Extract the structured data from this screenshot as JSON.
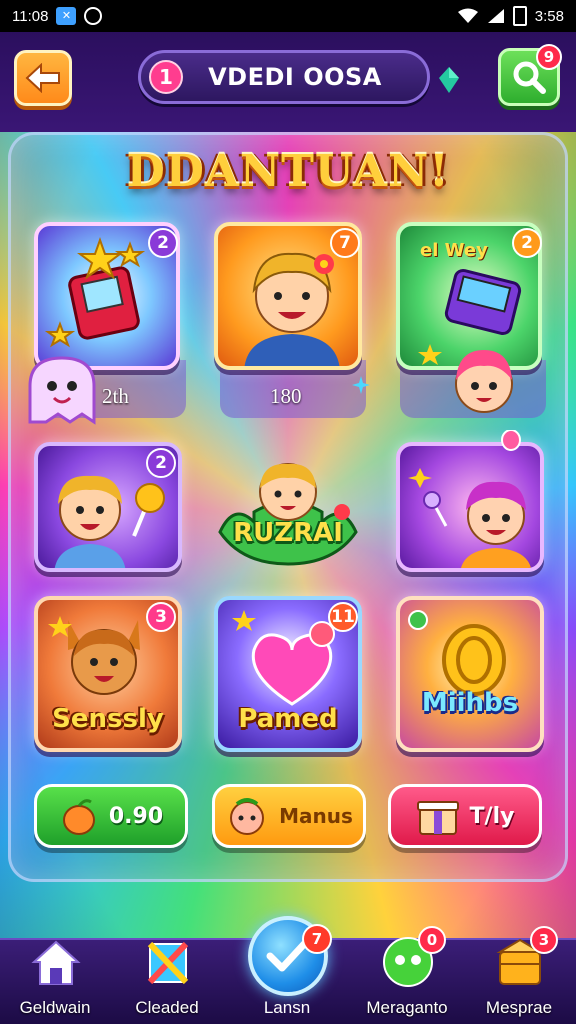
{
  "status_bar": {
    "time_left": "11:08",
    "time_right": "3:58"
  },
  "top_bar": {
    "level": "1",
    "title": "VDEDI OOSA",
    "search_badge": "9"
  },
  "headline": "DDANTUAN!",
  "cards": [
    {
      "id": "arcade",
      "badge": "2",
      "caption": "2th"
    },
    {
      "id": "boy-flower",
      "badge": "7",
      "caption": "180"
    },
    {
      "id": "chest",
      "badge": "2",
      "sign": "el Wey"
    },
    {
      "id": "fox-lollipop",
      "badge": "2"
    },
    {
      "id": "center-puzzle",
      "label": "RUZRAI"
    },
    {
      "id": "girl-wand"
    },
    {
      "id": "fox",
      "badge": "3",
      "label": "Senssly"
    },
    {
      "id": "heart",
      "badge": "11",
      "label": "Pamed"
    },
    {
      "id": "coin",
      "label": "Miihbs"
    }
  ],
  "buttons": [
    {
      "label": "0.90",
      "color": "#2bbf3a"
    },
    {
      "label": "Manus",
      "color": "#ffb21c"
    },
    {
      "label": "T/ly",
      "color": "#ff2d6a"
    }
  ],
  "bottom_nav": [
    {
      "label": "Geldwain"
    },
    {
      "label": "Cleaded"
    },
    {
      "label": "Lansn",
      "badge": "7"
    },
    {
      "label": "Meraganto",
      "badge": "0"
    },
    {
      "label": "Mesprae",
      "badge": "3"
    }
  ]
}
